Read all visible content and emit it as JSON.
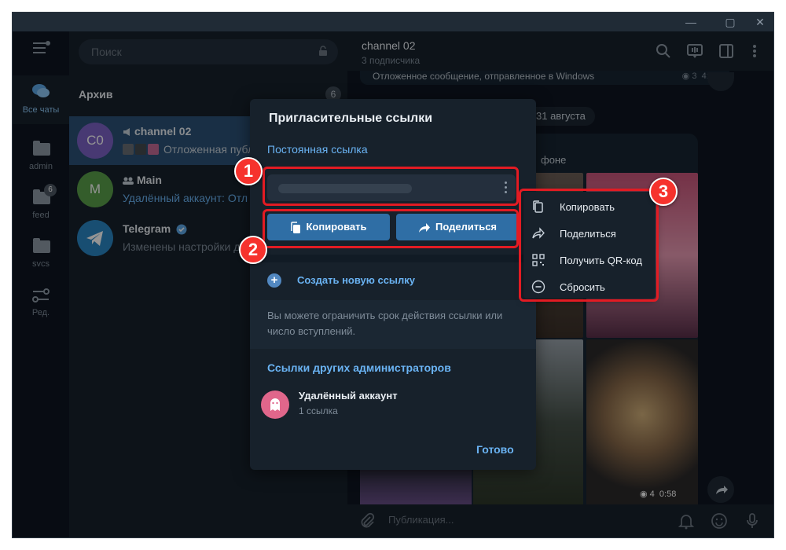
{
  "sidebar": {
    "items": [
      {
        "label": "Все чаты",
        "icon": "chats-icon",
        "active": true
      },
      {
        "label": "admin",
        "icon": "folder-icon"
      },
      {
        "label": "feed",
        "icon": "folder-icon",
        "badge": "6"
      },
      {
        "label": "svcs",
        "icon": "folder-icon"
      },
      {
        "label": "Ред.",
        "icon": "edit-folders-icon"
      }
    ]
  },
  "search": {
    "placeholder": "Поиск"
  },
  "archive": {
    "title": "Архив",
    "count": "6"
  },
  "chats": [
    {
      "avatar_text": "C0",
      "name": "channel 02",
      "preview": "Отложенная публ",
      "avatar_color": "#7c62c6"
    },
    {
      "avatar_text": "M",
      "name": "Main",
      "preview": "Удалённый аккаунт: Отл",
      "avatar_color": "#5aa04a"
    },
    {
      "avatar_text": "",
      "name": "Telegram",
      "preview": "Изменены настройки двух",
      "avatar_color": "#2a87c4"
    }
  ],
  "chat_header": {
    "title": "channel 02",
    "subtitle": "3 подписчика"
  },
  "messages": {
    "old_text": "Отложенное сообщение, отправленное в Windows",
    "old_views": "3",
    "old_time": "4:08",
    "date": "31 августа",
    "bubble_text": "фоне",
    "views": "4",
    "time": "0:58"
  },
  "composer": {
    "placeholder": "Публикация..."
  },
  "dialog": {
    "title": "Пригласительные ссылки",
    "permanent_label": "Постоянная ссылка",
    "copy_label": "Копировать",
    "share_label": "Поделиться",
    "create_label": "Создать новую ссылку",
    "hint": "Вы можете ограничить срок действия ссылки или число вступлений.",
    "others_title": "Ссылки других администраторов",
    "admin_name": "Удалённый аккаунт",
    "admin_links": "1 ссылка",
    "done_label": "Готово"
  },
  "context_menu": {
    "items": [
      {
        "label": "Копировать",
        "icon": "copy-icon"
      },
      {
        "label": "Поделиться",
        "icon": "share-icon"
      },
      {
        "label": "Получить QR-код",
        "icon": "qr-code-icon"
      },
      {
        "label": "Сбросить",
        "icon": "revoke-icon"
      }
    ]
  },
  "callouts": [
    "1",
    "2",
    "3"
  ],
  "colors": {
    "accent": "#6ab3f3",
    "button": "#2f6ea5",
    "highlight": "#e31b23",
    "bg": "#17212b"
  }
}
